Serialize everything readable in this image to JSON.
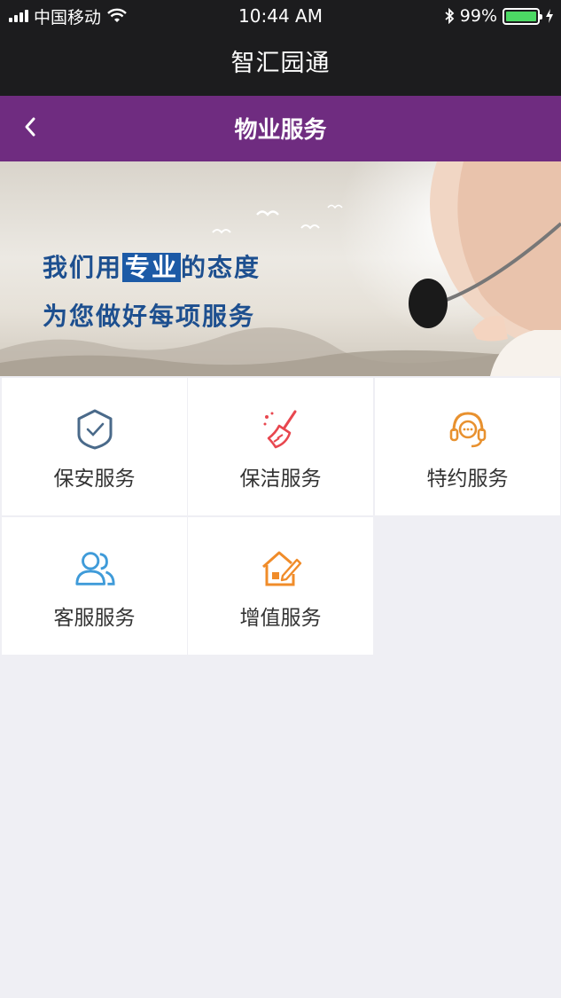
{
  "status_bar": {
    "carrier": "中国移动",
    "time": "10:44 AM",
    "battery": "99%",
    "icons": [
      "signal-icon",
      "wifi-icon",
      "bluetooth-icon",
      "battery-icon",
      "charging-icon"
    ]
  },
  "app": {
    "title": "智汇园通"
  },
  "nav": {
    "title": "物业服务",
    "back_icon": "chevron-left-icon"
  },
  "banner": {
    "line1_pre": "我们用",
    "line1_highlight": "专业",
    "line1_post": "的态度",
    "line2": "为您做好每项服务"
  },
  "services": [
    {
      "label": "保安服务",
      "icon": "shield-check-icon",
      "color": "#4a6a8a"
    },
    {
      "label": "保洁服务",
      "icon": "broom-icon",
      "color": "#e8474f"
    },
    {
      "label": "特约服务",
      "icon": "headset-icon",
      "color": "#e8912f"
    },
    {
      "label": "客服服务",
      "icon": "users-icon",
      "color": "#3f9bd9"
    },
    {
      "label": "增值服务",
      "icon": "house-edit-icon",
      "color": "#f08c2a"
    }
  ],
  "colors": {
    "nav_bg": "#6f2c80",
    "header_bg": "#1c1c1e",
    "page_bg": "#efeff4"
  }
}
